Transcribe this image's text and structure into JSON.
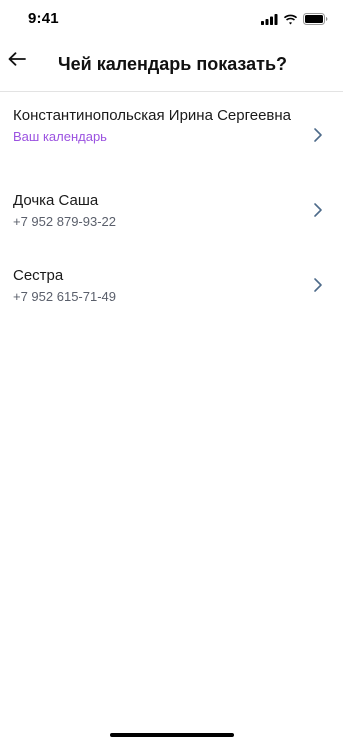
{
  "status_bar": {
    "time": "9:41",
    "icons": [
      "signal-icon",
      "wifi-icon",
      "battery-icon"
    ]
  },
  "header": {
    "back_icon": "arrow-left-icon",
    "title": "Чей календарь показать?"
  },
  "calendars": [
    {
      "name": "Константинопольская Ирина Сергеевна",
      "subtitle": "Ваш календарь",
      "subtitle_color": "#9b52e0"
    },
    {
      "name": "Дочка Саша",
      "subtitle": "+7 952 879-93-22"
    },
    {
      "name": "Сестра",
      "subtitle": "+7 952 615-71-49"
    }
  ],
  "colors": {
    "accent": "#9b52e0",
    "secondary_text": "#5a5f6b",
    "chevron": "#4d6b8a"
  }
}
